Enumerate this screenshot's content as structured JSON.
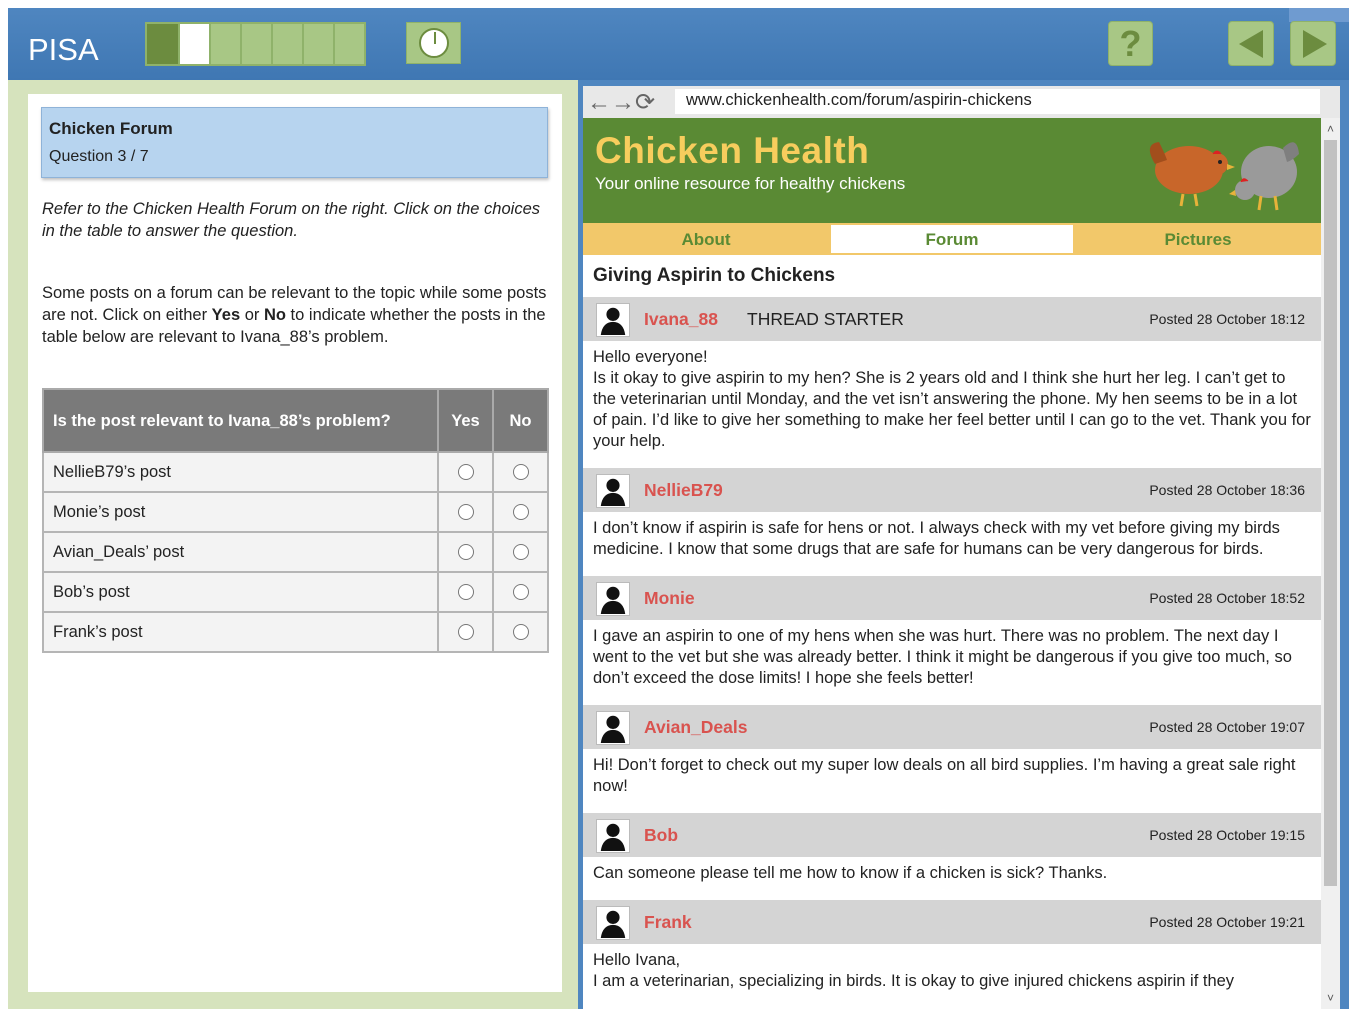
{
  "app": {
    "brand": "PISA",
    "progress_segments": 7,
    "progress_current": 2,
    "help_label": "?"
  },
  "question": {
    "title": "Chicken Forum",
    "number": "Question 3 / 7",
    "instruction": "Refer to the Chicken Health Forum on the right. Click on the choices in the table to answer the question.",
    "description_parts": [
      "Some posts on a forum can be relevant to the topic while some posts are not. Click on either ",
      "Yes",
      " or ",
      "No",
      " to indicate whether the posts in the table below are relevant to Ivana_88’s problem."
    ],
    "table": {
      "header": "Is the post relevant to Ivana_88’s problem?",
      "yes": "Yes",
      "no": "No",
      "rows": [
        "NellieB79’s post",
        "Monie’s post",
        "Avian_Deals’ post",
        "Bob’s post",
        "Frank’s post"
      ]
    }
  },
  "browser": {
    "url": "www.chickenhealth.com/forum/aspirin-chickens",
    "site_title": "Chicken Health",
    "tagline": "Your online resource for healthy chickens",
    "tabs": [
      "About",
      "Forum",
      "Pictures"
    ],
    "active_tab": "Forum",
    "thread_title": "Giving Aspirin to Chickens"
  },
  "posts": [
    {
      "user": "Ivana_88",
      "badge": "THREAD STARTER",
      "posted": "Posted 28 October 18:12",
      "lines": [
        "Hello everyone!",
        "Is it okay to give aspirin to my hen? She is 2 years old and I think she hurt her leg. I can’t get to the veterinarian until Monday, and the vet isn’t answering the phone. My hen seems to be in a lot of pain. I’d like to give her something to make her feel better until I can go to the vet. Thank you for your help."
      ]
    },
    {
      "user": "NellieB79",
      "badge": "",
      "posted": "Posted 28 October 18:36",
      "lines": [
        "I don’t know if aspirin is safe for hens or not. I always check with my vet before giving my birds medicine. I know that some drugs that are safe for humans can be very dangerous for birds."
      ]
    },
    {
      "user": "Monie",
      "badge": "",
      "posted": "Posted 28 October 18:52",
      "lines": [
        "I gave an aspirin to one of my hens when she was hurt. There was no problem. The next day I went to the vet but she was already better. I think it might be dangerous if you give too much, so don’t exceed the dose limits! I hope she feels better!"
      ]
    },
    {
      "user": "Avian_Deals",
      "badge": "",
      "posted": "Posted 28 October 19:07",
      "lines": [
        "Hi! Don’t forget to check out my super low deals on all bird supplies. I’m having a great sale right now!"
      ]
    },
    {
      "user": "Bob",
      "badge": "",
      "posted": "Posted 28 October 19:15",
      "lines": [
        "Can someone please tell me how to know if a chicken is sick? Thanks."
      ]
    },
    {
      "user": "Frank",
      "badge": "",
      "posted": "Posted 28 October 19:21",
      "lines": [
        "Hello Ivana,",
        "I am a veterinarian, specializing in birds. It is okay to give injured chickens aspirin if they"
      ]
    }
  ],
  "colors": {
    "top_bar": "#4f86c0",
    "left_bg": "#d6e3bd",
    "progress_green": "#a8c785",
    "banner_green": "#5a8a34",
    "site_title_yellow": "#f7cd5d",
    "tab_yellow": "#f2c86a",
    "username_red": "#d9534f"
  },
  "icons": [
    "clock-icon",
    "help-icon",
    "back-arrow-icon",
    "forward-arrow-icon",
    "browser-back-icon",
    "browser-forward-icon",
    "reload-icon",
    "user-avatar-icon",
    "hen-illustration"
  ]
}
